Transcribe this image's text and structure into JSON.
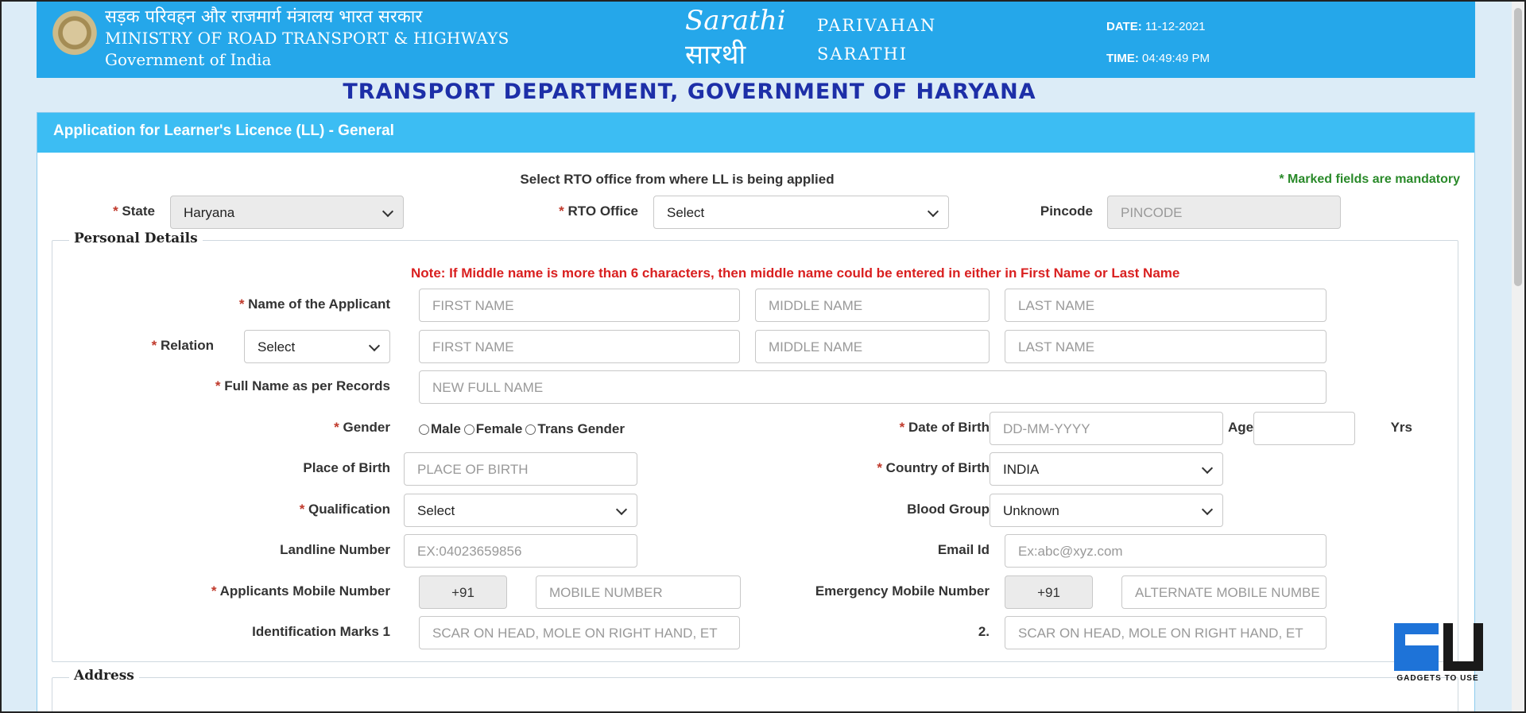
{
  "header": {
    "ministry_hindi": "सड़क परिवहन और राजमार्ग मंत्रालय भारत सरकार",
    "ministry_english": "MINISTRY OF ROAD TRANSPORT & HIGHWAYS",
    "government": "Government of India",
    "logo_text_en": "Sarathi",
    "logo_text_hi": "सारथी",
    "brand_line1": "PARIVAHAN",
    "brand_line2": "SARATHI",
    "date_label": "DATE:",
    "date_value": "11-12-2021",
    "time_label": "TIME:",
    "time_value": "04:49:49 PM"
  },
  "department_title": "TRANSPORT DEPARTMENT, GOVERNMENT OF HARYANA",
  "panel_title": "Application for Learner's Licence (LL) - General",
  "rto_section": {
    "instruction": "Select RTO office from where LL is being applied",
    "mandatory_note": "* Marked fields are mandatory",
    "state_label": "State",
    "state_value": "Haryana",
    "rto_label": "RTO Office",
    "rto_value": "Select",
    "pincode_label": "Pincode",
    "pincode_placeholder": "PINCODE"
  },
  "personal": {
    "legend": "Personal Details",
    "note": "Note: If Middle name is more than 6 characters, then middle name could be entered in either in First Name or Last Name",
    "name_label": "Name of the Applicant",
    "first_name_ph": "FIRST NAME",
    "middle_name_ph": "MIDDLE NAME",
    "last_name_ph": "LAST NAME",
    "relation_label": "Relation",
    "relation_value": "Select",
    "full_name_label": "Full Name as per Records",
    "full_name_ph": "NEW FULL NAME",
    "gender_label": "Gender",
    "gender_options": [
      "Male",
      "Female",
      "Trans Gender"
    ],
    "dob_label": "Date of Birth",
    "dob_ph": "DD-MM-YYYY",
    "age_label": "Age",
    "yrs_label": "Yrs",
    "pob_label": "Place of Birth",
    "pob_ph": "PLACE OF BIRTH",
    "country_label": "Country of Birth",
    "country_value": "INDIA",
    "qualification_label": "Qualification",
    "qualification_value": "Select",
    "blood_label": "Blood Group",
    "blood_value": "Unknown",
    "landline_label": "Landline Number",
    "landline_ph": "EX:04023659856",
    "email_label": "Email Id",
    "email_ph": "Ex:abc@xyz.com",
    "mobile_label": "Applicants Mobile Number",
    "mobile_code": "+91",
    "mobile_ph": "MOBILE NUMBER",
    "emergency_label": "Emergency Mobile Number",
    "emergency_code": "+91",
    "emergency_ph": "ALTERNATE MOBILE NUMBE",
    "marks1_label": "Identification Marks 1",
    "marks1_ph": "SCAR ON HEAD, MOLE ON RIGHT HAND, ET",
    "marks2_label": "2.",
    "marks2_ph": "SCAR ON HEAD, MOLE ON RIGHT HAND, ET"
  },
  "address": {
    "legend": "Address"
  },
  "watermark": {
    "text": "GADGETS TO USE"
  }
}
